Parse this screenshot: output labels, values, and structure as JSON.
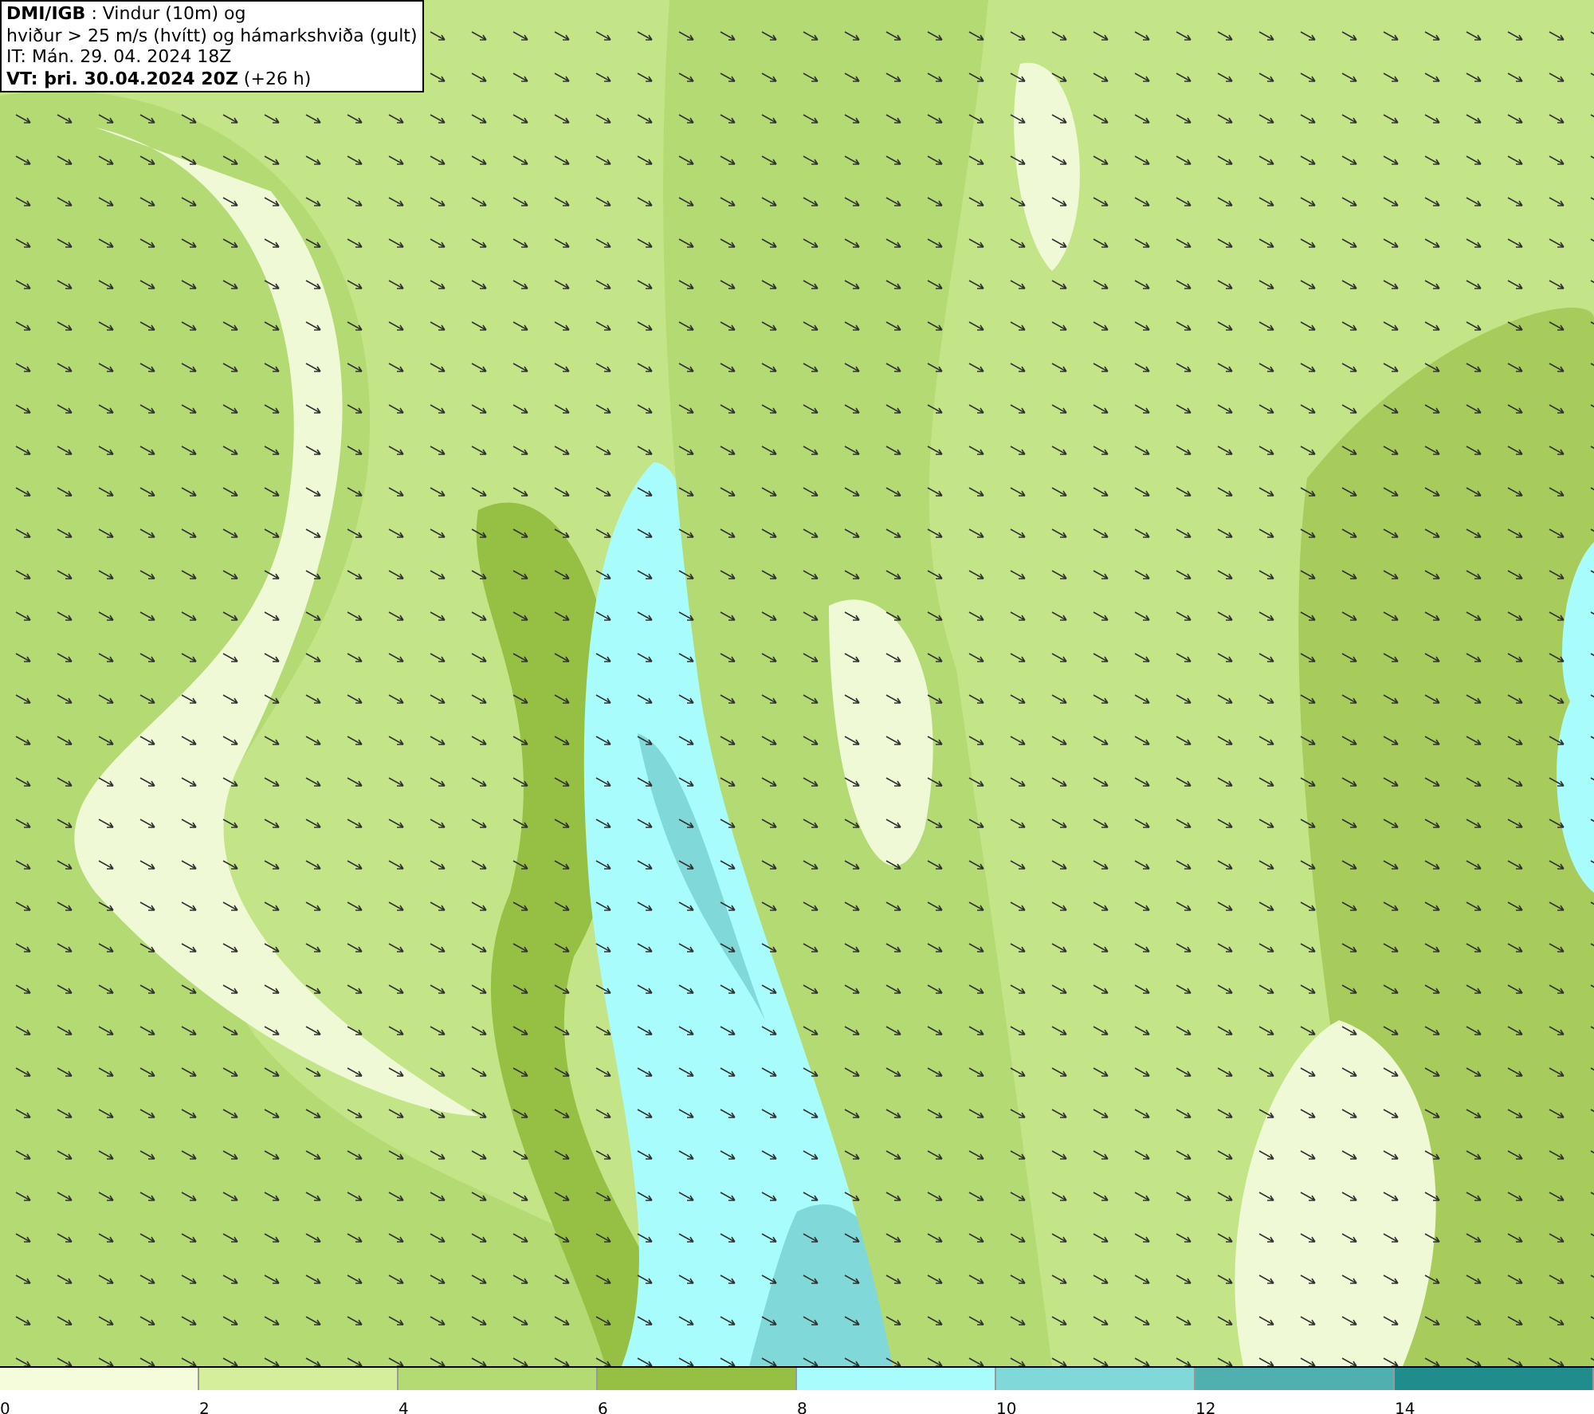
{
  "header": {
    "lines": [
      "**DMI/IGB** : Vindur (10m) og",
      "hviður > 25 m/s (hvítt) og hámarkshviða (gult)",
      "IT: Mán. 29. 04. 2024 18Z",
      "**VT: þri. 30.04.2024 20Z** (+26 h)"
    ]
  },
  "legend": {
    "bins": [
      {
        "color": "#f4fcdc"
      },
      {
        "color": "#d4ee9c"
      },
      {
        "color": "#b4da74"
      },
      {
        "color": "#96c044"
      },
      {
        "color": "#a8fcfc"
      },
      {
        "color": "#80d8d8"
      },
      {
        "color": "#50b0b0"
      },
      {
        "color": "#208c8c"
      }
    ],
    "ticks": [
      "0",
      "2",
      "4",
      "6",
      "8",
      "10",
      "12",
      "14"
    ]
  }
}
